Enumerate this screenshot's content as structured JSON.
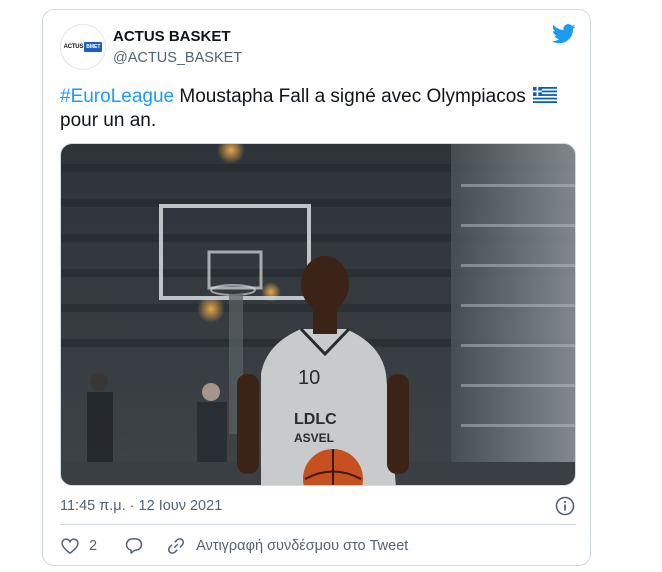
{
  "author": {
    "name": "ACTUS BASKET",
    "handle": "@ACTUS_BASKET",
    "avatar_logo": [
      "ACTUS",
      "BMET"
    ]
  },
  "tweet": {
    "hashtag": "#EuroLeague",
    "text_line1": " Moustapha Fall a signé avec Olympiacos",
    "text_line2": "pour un an.",
    "flag": "greece-flag"
  },
  "media": {
    "jersey_number": "10",
    "jersey_sponsor_1": "LDLC",
    "jersey_sponsor_2": "ASVEL"
  },
  "meta": {
    "timestamp": "11:45 π.μ. · 12 Ιουν 2021"
  },
  "actions": {
    "like_count": "2",
    "copy_link_label": "Αντιγραφή συνδέσμου στο Tweet"
  },
  "colors": {
    "accent": "#1d9bf0",
    "secondary_text": "#536471",
    "border": "#cfd9de"
  },
  "icons": [
    "twitter-bird-icon",
    "info-icon",
    "heart-icon",
    "reply-icon",
    "link-icon"
  ]
}
